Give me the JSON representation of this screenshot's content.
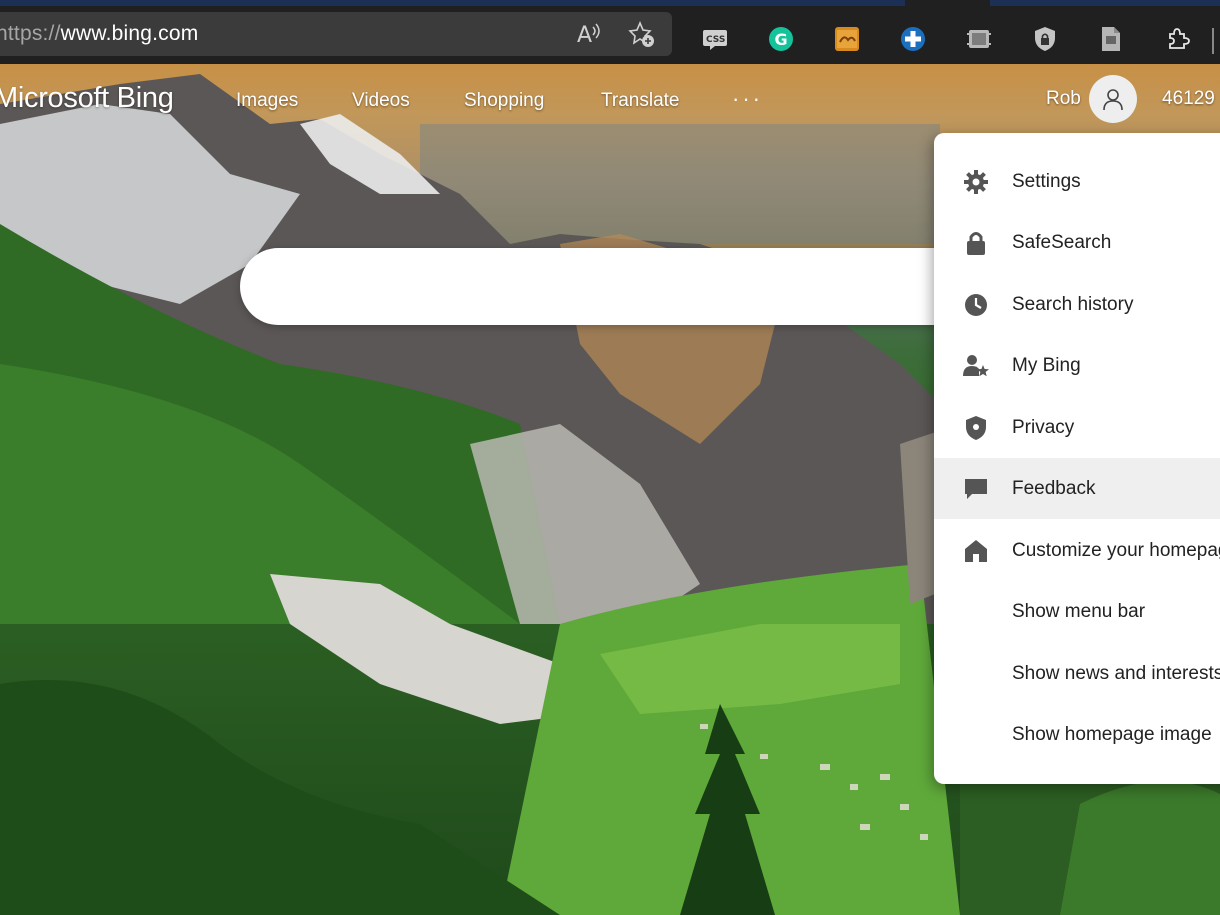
{
  "browser": {
    "url_scheme": "https://",
    "url_host": "www.bing.com",
    "address_icons": [
      "read-aloud-icon",
      "add-favorite-icon"
    ],
    "extensions": [
      "css-viewer-icon",
      "grammarly-icon",
      "amazon-assistant-icon",
      "cross-extension-icon",
      "screen-capture-icon",
      "shield-lock-icon",
      "document-icon",
      "extensions-puzzle-icon"
    ]
  },
  "header": {
    "brand": "Microsoft Bing",
    "nav": [
      "Images",
      "Videos",
      "Shopping",
      "Translate"
    ],
    "more": "···",
    "user_name": "Rob",
    "points": "46129"
  },
  "menu": {
    "items": [
      {
        "label": "Settings",
        "icon": "gear-icon"
      },
      {
        "label": "SafeSearch",
        "icon": "lock-icon"
      },
      {
        "label": "Search history",
        "icon": "clock-icon"
      },
      {
        "label": "My Bing",
        "icon": "person-star-icon"
      },
      {
        "label": "Privacy",
        "icon": "shield-icon"
      },
      {
        "label": "Feedback",
        "icon": "chat-bubble-icon"
      },
      {
        "label": "Customize your homepage",
        "icon": "home-icon"
      },
      {
        "label": "Show menu bar",
        "icon": ""
      },
      {
        "label": "Show news and interests",
        "icon": ""
      },
      {
        "label": "Show homepage image",
        "icon": ""
      }
    ],
    "highlighted_index": 5
  },
  "colors": {
    "chrome": "#202020",
    "address_bar": "#3b3b3b",
    "menu_bg": "#ffffff",
    "menu_highlight": "#efefef",
    "grammarly": "#15c39a"
  }
}
